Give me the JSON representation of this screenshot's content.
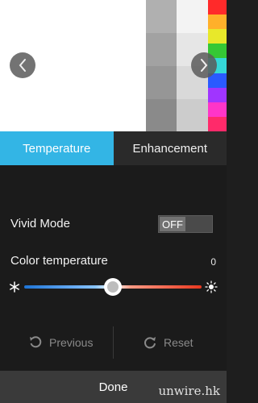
{
  "tabs": [
    {
      "label": "Temperature",
      "active": true
    },
    {
      "label": "Enhancement",
      "active": false
    }
  ],
  "vivid_mode": {
    "label": "Vivid Mode",
    "toggle_text": "OFF",
    "on": false
  },
  "color_temperature": {
    "label": "Color temperature",
    "value": "0",
    "slider_fraction": 0.5
  },
  "actions": {
    "previous": "Previous",
    "reset": "Reset"
  },
  "done_label": "Done",
  "watermark": "unwire.hk",
  "colors": {
    "accent": "#33b5e5",
    "gray_col_1": [
      "#b0b0b0",
      "#a2a2a2",
      "#969696",
      "#8a8a8a"
    ],
    "gray_col_2": [
      "#f3f3f3",
      "#e6e6e6",
      "#d9d9d9",
      "#cccccc"
    ],
    "color_col": [
      "#ff2a2a",
      "#ffb02a",
      "#e8e82a",
      "#35c835",
      "#35d8d8",
      "#2a5aff",
      "#a035ff",
      "#ff35c8",
      "#ff2a6a"
    ]
  }
}
